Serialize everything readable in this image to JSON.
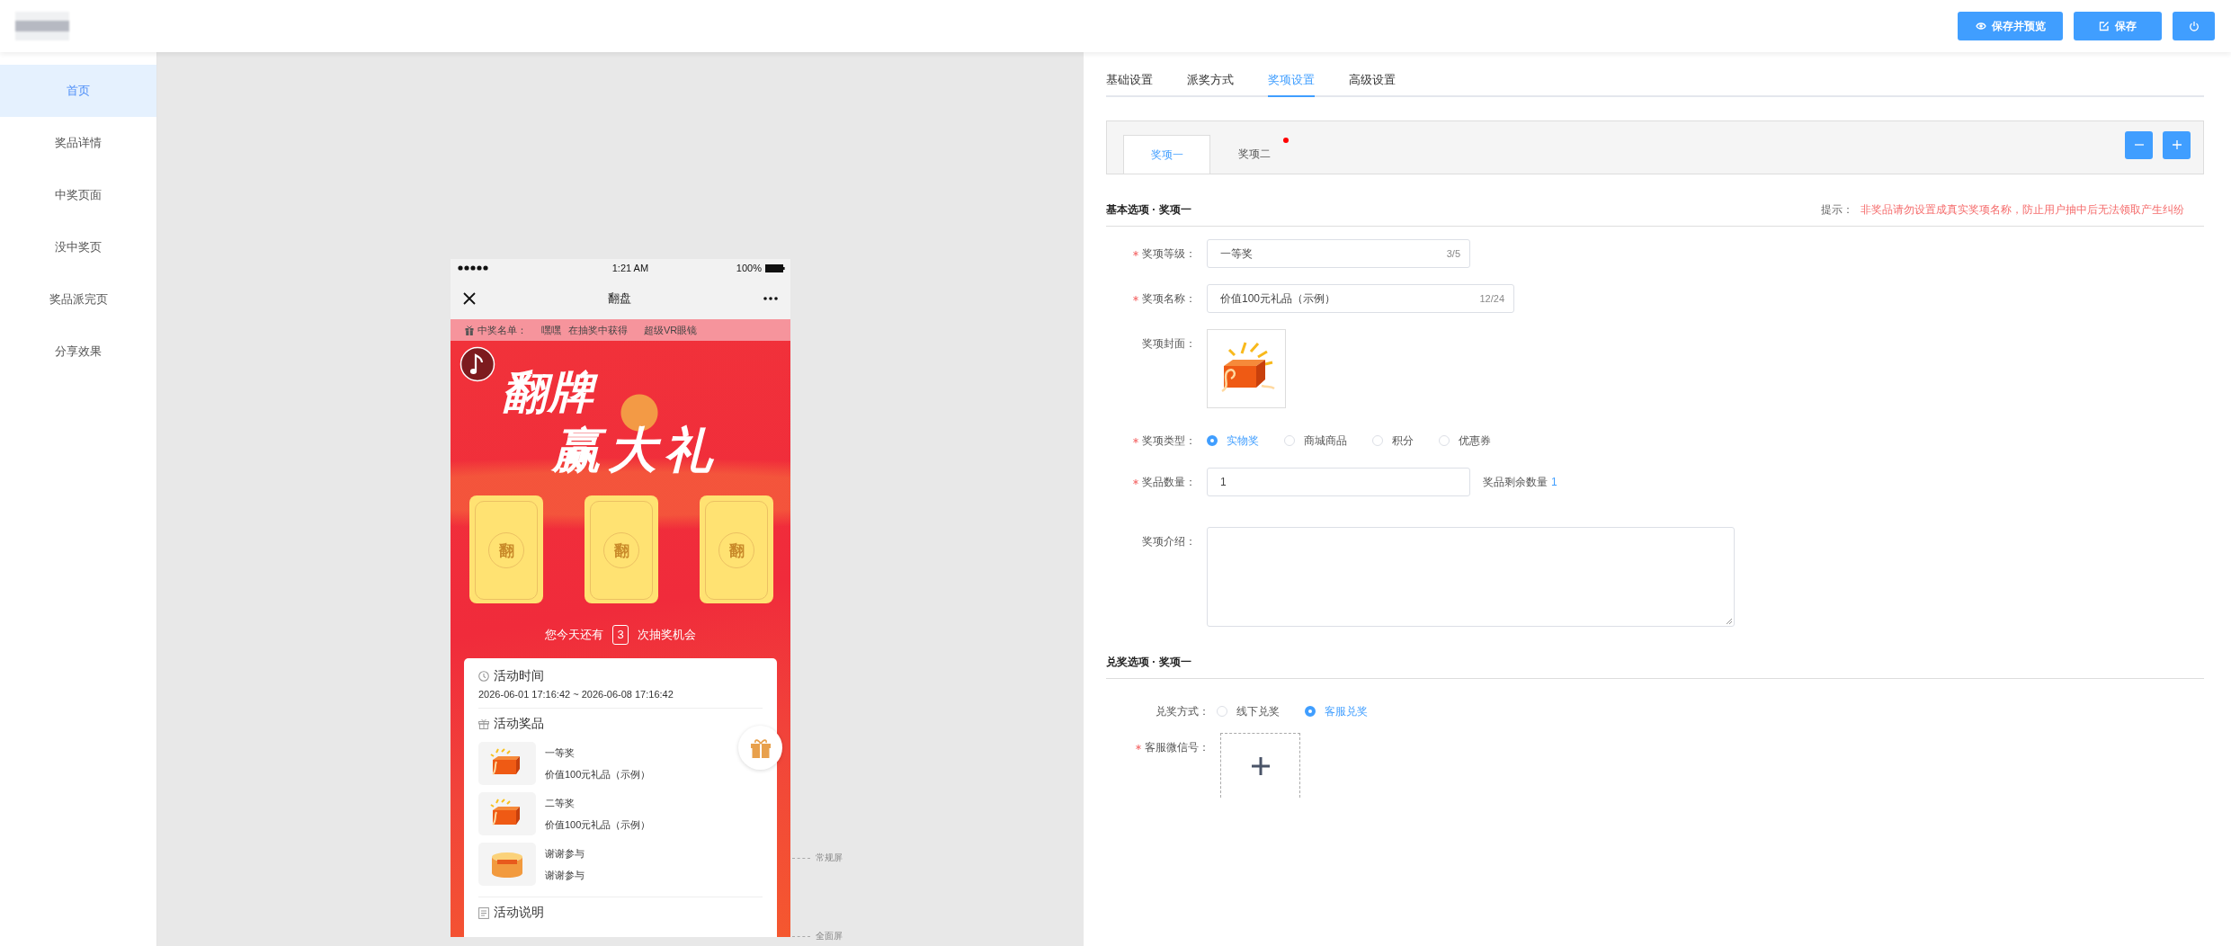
{
  "header": {
    "buttons": [
      {
        "kind": "preview",
        "label": "保存并预览"
      },
      {
        "kind": "save",
        "label": "保存"
      },
      {
        "kind": "power"
      }
    ]
  },
  "sidebar": {
    "items": [
      {
        "label": "首页",
        "selected": true
      },
      {
        "label": "奖品详情",
        "selected": false
      },
      {
        "label": "中奖页面",
        "selected": false
      },
      {
        "label": "没中奖页",
        "selected": false
      },
      {
        "label": "奖品派完页",
        "selected": false
      },
      {
        "label": "分享效果",
        "selected": false
      }
    ]
  },
  "phone": {
    "status_bar": {
      "time": "1:21 AM",
      "battery": "100%"
    },
    "nav_title": "翻盘",
    "winners": {
      "label": "中奖名单：",
      "name": "嘿嘿",
      "action": "在抽奖中获得",
      "prize": "超级VR眼镜"
    },
    "hero_title": [
      "翻牌",
      "赢大礼"
    ],
    "cards": [
      {
        "face": "翻"
      },
      {
        "face": "翻"
      },
      {
        "face": "翻"
      }
    ],
    "chances": {
      "prefix": "您今天还有",
      "count": "3",
      "suffix": "次抽奖机会"
    },
    "time_section": {
      "title": "活动时间",
      "range": "2026-06-01 17:16:42 ~ 2026-06-08 17:16:42"
    },
    "prizes_section": {
      "title": "活动奖品",
      "items": [
        {
          "kind": "gift",
          "level": "一等奖",
          "name": "价值100元礼品（示例）"
        },
        {
          "kind": "gift",
          "level": "二等奖",
          "name": "价值100元礼品（示例）"
        },
        {
          "kind": "thanks",
          "level": "谢谢参与",
          "name": "谢谢参与"
        }
      ]
    },
    "notes_section": {
      "title": "活动说明"
    }
  },
  "screen_markers": [
    "常规屏",
    "全面屏"
  ],
  "settings": {
    "tabs": [
      {
        "label": "基础设置",
        "selected": false
      },
      {
        "label": "派奖方式",
        "selected": false
      },
      {
        "label": "奖项设置",
        "selected": true
      },
      {
        "label": "高级设置",
        "selected": false
      }
    ],
    "prize_tabs": [
      {
        "label": "奖项一",
        "selected": true,
        "dot": false
      },
      {
        "label": "奖项二",
        "selected": false,
        "dot": true
      }
    ],
    "basic": {
      "title": "基本选项 · 奖项一",
      "tip_label": "提示：",
      "tip": "非奖品请勿设置成真实奖项名称，防止用户抽中后无法领取产生纠纷"
    },
    "basic_fields": [
      {
        "kind": "text",
        "label": "奖项等级：",
        "required": true,
        "value": "一等奖",
        "counter": "3/5"
      },
      {
        "kind": "text",
        "label": "奖项名称：",
        "required": true,
        "value": "价值100元礼品（示例）",
        "counter": "12/24"
      },
      {
        "kind": "image",
        "label": "奖项封面：",
        "required": false
      },
      {
        "kind": "radio",
        "label": "奖项类型：",
        "required": true,
        "options": [
          {
            "label": "实物奖",
            "selected": true
          },
          {
            "label": "商城商品",
            "selected": false
          },
          {
            "label": "积分",
            "selected": false
          },
          {
            "label": "优惠券",
            "selected": false
          }
        ]
      },
      {
        "kind": "number",
        "label": "奖品数量：",
        "required": true,
        "value": "1",
        "note": "奖品剩余数量",
        "note_value": "1"
      },
      {
        "kind": "textarea",
        "label": "奖项介绍：",
        "required": false
      }
    ],
    "redeem": {
      "title": "兑奖选项 · 奖项一"
    },
    "redeem_fields": [
      {
        "kind": "radio",
        "label": "兑奖方式：",
        "required": false,
        "options": [
          {
            "label": "线下兑奖",
            "selected": false
          },
          {
            "label": "客服兑奖",
            "selected": true
          }
        ]
      },
      {
        "kind": "upload",
        "label": "客服微信号：",
        "required": true
      }
    ]
  }
}
